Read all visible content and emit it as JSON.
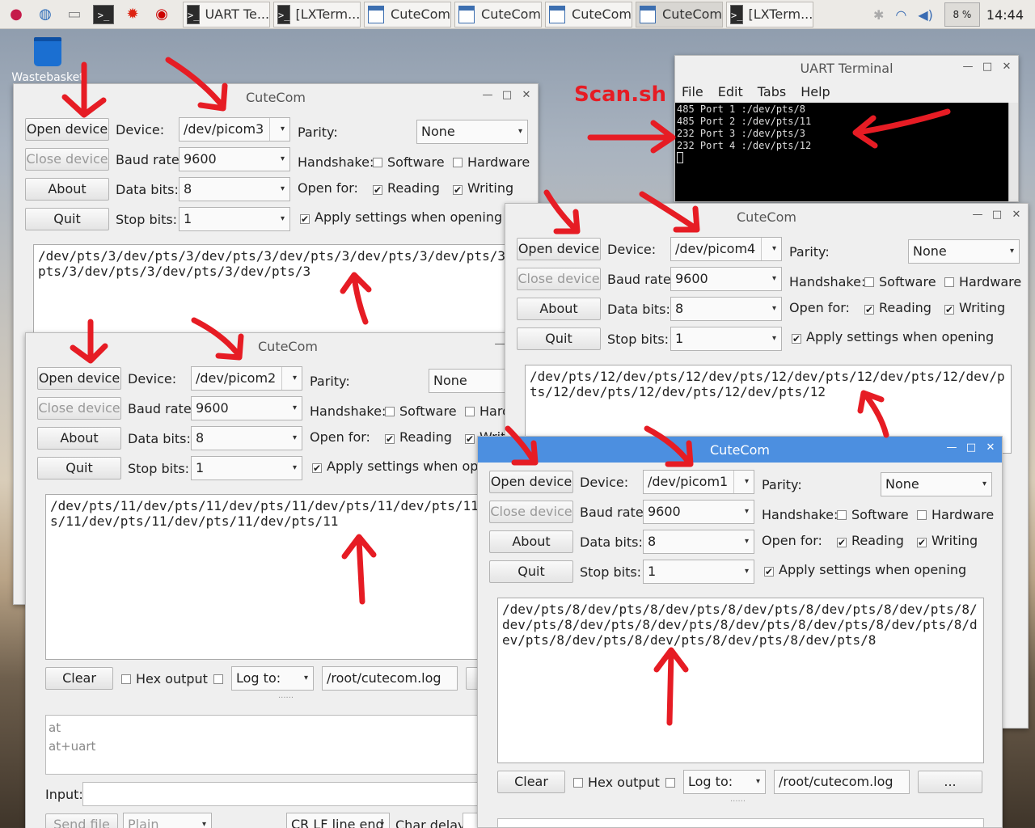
{
  "taskbar": {
    "launchers": [
      "raspberry-menu-icon",
      "globe-browser-icon",
      "file-manager-icon",
      "terminal-icon",
      "burst-app-icon",
      "wolfram-icon"
    ],
    "tasks": [
      "UART Te...",
      "[LXTerm...",
      "CuteCom",
      "CuteCom",
      "CuteCom",
      "CuteCom",
      "[LXTerm..."
    ],
    "cpu": "8 %",
    "clock": "14:44"
  },
  "desktop": {
    "trash_label": "Wastebasket"
  },
  "uart": {
    "title": "UART Terminal",
    "menu": [
      "File",
      "Edit",
      "Tabs",
      "Help"
    ],
    "lines": [
      "485 Port 1 :/dev/pts/8",
      "485 Port 2 :/dev/pts/11",
      "232 Port 3 :/dev/pts/3",
      "232 Port 4 :/dev/pts/12"
    ]
  },
  "annotation": {
    "label": "Scan.sh"
  },
  "common": {
    "open_device": "Open device",
    "close_device": "Close device",
    "about": "About",
    "quit": "Quit",
    "device": "Device:",
    "baud_rate": "Baud rate:",
    "data_bits": "Data bits:",
    "stop_bits": "Stop bits:",
    "parity": "Parity:",
    "handshake": "Handshake:",
    "open_for": "Open for:",
    "software": "Software",
    "hardware": "Hardware",
    "reading": "Reading",
    "writing": "Writing",
    "apply": "Apply settings when opening",
    "baud": "9600",
    "databits": "8",
    "stopbits": "1",
    "parity_val": "None",
    "clear": "Clear",
    "hex_output": "Hex output",
    "log_to": "Log to:",
    "log_path": "/root/cutecom.log",
    "browse": "...",
    "input": "Input:",
    "send_file": "Send file",
    "plain": "Plain",
    "line_end": "CR LF line end",
    "char_delay": "Char delay:",
    "check": "✔"
  },
  "windows": [
    {
      "title": "CuteCom",
      "device": "/dev/picom3",
      "output": "/dev/pts/3/dev/pts/3/dev/pts/3/dev/pts/3/dev/pts/3/dev/pts/3/dev/pts/3/dev/pts/3/dev/pts/3/dev/pts/3"
    },
    {
      "title": "CuteCom",
      "device": "/dev/picom2",
      "output": "/dev/pts/11/dev/pts/11/dev/pts/11/dev/pts/11/dev/pts/11/dev/pts/11/dev/pts/11/dev/pts/11/dev/pts/11",
      "history": [
        "at",
        "at+uart"
      ]
    },
    {
      "title": "CuteCom",
      "device": "/dev/picom4",
      "output": "/dev/pts/12/dev/pts/12/dev/pts/12/dev/pts/12/dev/pts/12/dev/pts/12/dev/pts/12/dev/pts/12/dev/pts/12"
    },
    {
      "title": "CuteCom",
      "device": "/dev/picom1",
      "output": "/dev/pts/8/dev/pts/8/dev/pts/8/dev/pts/8/dev/pts/8/dev/pts/8/dev/pts/8/dev/pts/8/dev/pts/8/dev/pts/8/dev/pts/8/dev/pts/8/dev/pts/8/dev/pts/8/dev/pts/8/dev/pts/8/dev/pts/8"
    }
  ]
}
